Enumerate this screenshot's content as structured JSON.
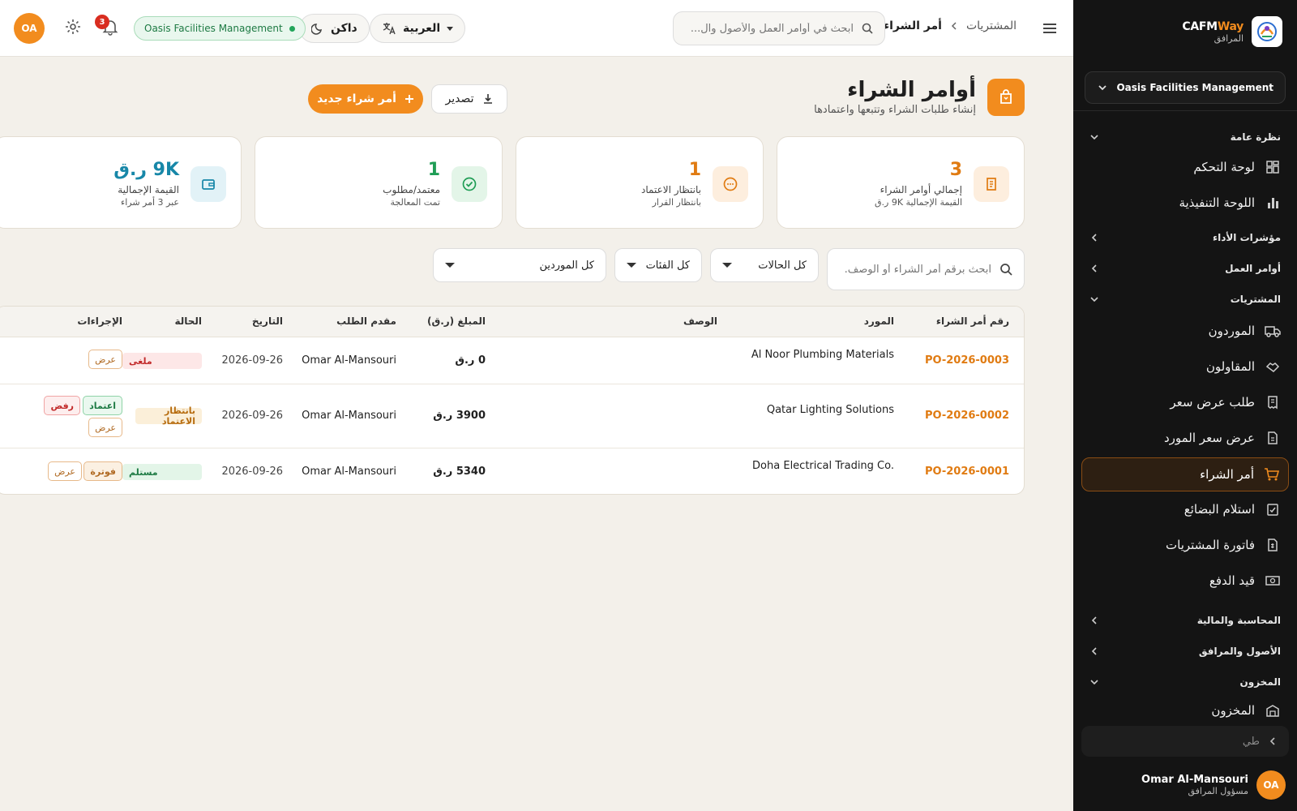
{
  "sidebar": {
    "brand_name_a": "CAFM",
    "brand_name_b": "Way",
    "brand_sub": "المرافق",
    "org": "Oasis Facilities Management",
    "sections": {
      "overview": "نظرة عامة",
      "kpis": "مؤشرات الأداء",
      "work_orders": "أوامر العمل",
      "procurement": "المشتريات",
      "finance": "المحاسبة والمالية",
      "assets": "الأصول والمرافق",
      "inventory": "المخزون"
    },
    "items": {
      "dashboard": "لوحة التحكم",
      "executive": "اللوحة التنفيذية",
      "vendors": "الموردون",
      "contractors": "المقاولون",
      "rfq": "طلب عرض سعر",
      "vendor_quote": "عرض سعر المورد",
      "purchase_order": "أمر الشراء",
      "goods_receipt": "استلام البضائع",
      "purchase_invoice": "فاتورة المشتريات",
      "payment": "قيد الدفع",
      "inventory": "المخزون"
    },
    "collapse_label": "طي",
    "user": {
      "initials": "OA",
      "name": "Omar Al-Mansouri",
      "role": "مسؤول المرافق"
    }
  },
  "topbar": {
    "breadcrumb_parent": "المشتريات",
    "breadcrumb_current": "أمر الشراء",
    "search_placeholder": "ابحث في أوامر العمل والأصول وال...",
    "language": "العربية",
    "theme": "داكن",
    "org": "Oasis Facilities Management",
    "notifications": "3",
    "avatar": "OA"
  },
  "page": {
    "title": "أوامر الشراء",
    "subtitle": "إنشاء طلبات الشراء وتتبعها واعتمادها",
    "export": "تصدير",
    "new_po": "أمر شراء جديد"
  },
  "kpis": [
    {
      "value": "3",
      "label": "إجمالي أوامر الشراء",
      "sub": "القيمة الإجمالية 9K ر.ق",
      "color": "#e07b12"
    },
    {
      "value": "1",
      "label": "بانتظار الاعتماد",
      "sub": "بانتظار القرار",
      "color": "#e07b12"
    },
    {
      "value": "1",
      "label": "معتمد/مطلوب",
      "sub": "تمت المعالجة",
      "color": "#1f9d55"
    },
    {
      "value": "9K ر.ق",
      "label": "القيمة الإجمالية",
      "sub": "عبر 3 أمر شراء",
      "color": "#1787a8"
    }
  ],
  "filters": {
    "search_placeholder": "ابحث برقم أمر الشراء أو الوصف...",
    "status": "كل الحالات",
    "category": "كل الفئات",
    "vendor": "كل الموردين"
  },
  "table": {
    "headers": {
      "po_number": "رقم أمر الشراء",
      "vendor": "المورد",
      "description": "الوصف",
      "amount": "المبلغ (ر.ق)",
      "requester": "مقدم الطلب",
      "date": "التاريخ",
      "status": "الحالة",
      "actions": "الإجراءات"
    },
    "rows": [
      {
        "po": "PO-2026-0003",
        "vendor": "Al Noor Plumbing Materials",
        "amount": "0 ر.ق",
        "requester": "Omar Al-Mansouri",
        "date": "2026-09-26",
        "status": "ملغى",
        "actions": [
          "عرض"
        ]
      },
      {
        "po": "PO-2026-0002",
        "vendor": "Qatar Lighting Solutions",
        "amount": "3900 ر.ق",
        "requester": "Omar Al-Mansouri",
        "date": "2026-09-26",
        "status": "بانتظار الاعتماد",
        "actions": [
          "اعتماد",
          "رفض",
          "عرض"
        ]
      },
      {
        "po": "PO-2026-0001",
        "vendor": "Doha Electrical Trading Co.",
        "amount": "5340 ر.ق",
        "requester": "Omar Al-Mansouri",
        "date": "2026-09-26",
        "status": "مستلم",
        "actions": [
          "فوترة",
          "عرض"
        ]
      }
    ]
  },
  "colors": {
    "accent": "#f28c1e",
    "sidebar_bg": "#141414",
    "page_bg": "#f3f0ea"
  }
}
